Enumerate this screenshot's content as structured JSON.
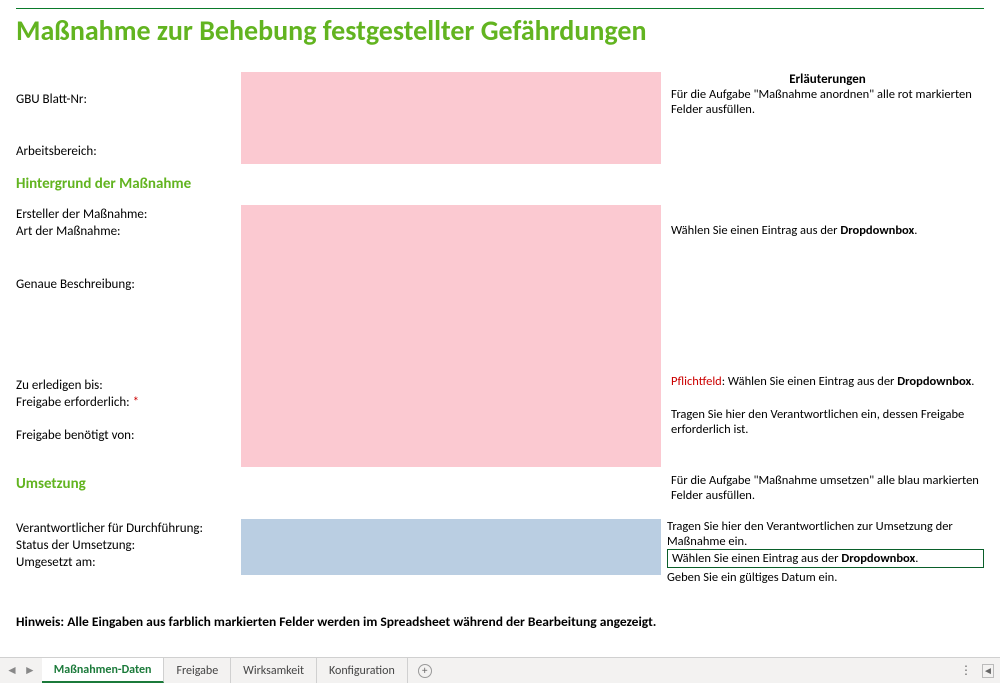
{
  "title": "Maßnahme zur Behebung festgestellter Gefährdungen",
  "erl_head": "Erläuterungen",
  "hints": {
    "top": "Für die Aufgabe  \"Maßnahme anordnen\" alle rot markierten Felder ausfüllen.",
    "art": [
      "Wählen Sie einen Eintrag aus der ",
      "Dropdownbox",
      "."
    ],
    "freigabe_erf": [
      "Pflichtfeld",
      ": Wählen Sie einen Eintrag aus der ",
      "Dropdownbox",
      "."
    ],
    "freigabe_von": "Tragen Sie hier den Verantwortlichen ein, dessen Freigabe erforderlich ist.",
    "umsetzung_head": "Für die Aufgabe  \"Maßnahme umsetzen\" alle blau markierten Felder ausfüllen.",
    "verantw": "Tragen Sie hier den Verantwortlichen zur Umsetzung der Maßnahme ein.",
    "status": [
      "Wählen Sie einen Eintrag aus der ",
      "Dropdownbox",
      "."
    ],
    "umgesetzt": "Geben Sie ein gültiges Datum ein."
  },
  "labels": {
    "gbu": "GBU Blatt-Nr:",
    "arbeitsbereich": "Arbeitsbereich:",
    "hintergrund": "Hintergrund der Maßnahme",
    "ersteller": "Ersteller der Maßnahme:",
    "art": "Art der Maßnahme:",
    "beschreibung": "Genaue Beschreibung:",
    "erledigen": "Zu erledigen bis:",
    "freigabe_erf": "Freigabe erforderlich: ",
    "freigabe_von": "Freigabe benötigt von:",
    "umsetzung": "Umsetzung",
    "verantw": "Verantwortlicher für Durchführung:",
    "status": "Status der Umsetzung:",
    "umgesetzt": "Umgesetzt am:"
  },
  "star": "*",
  "note": "Hinweis: Alle Eingaben aus farblich markierten Felder werden im Spreadsheet während der Bearbeitung angezeigt.",
  "tabs": {
    "nav_prev": "◄",
    "nav_next": "►",
    "t1": "Maßnahmen-Daten",
    "t2": "Freigabe",
    "t3": "Wirksamkeit",
    "t4": "Konfiguration",
    "add": "+",
    "dots": "⋮",
    "scroll": "◄"
  }
}
